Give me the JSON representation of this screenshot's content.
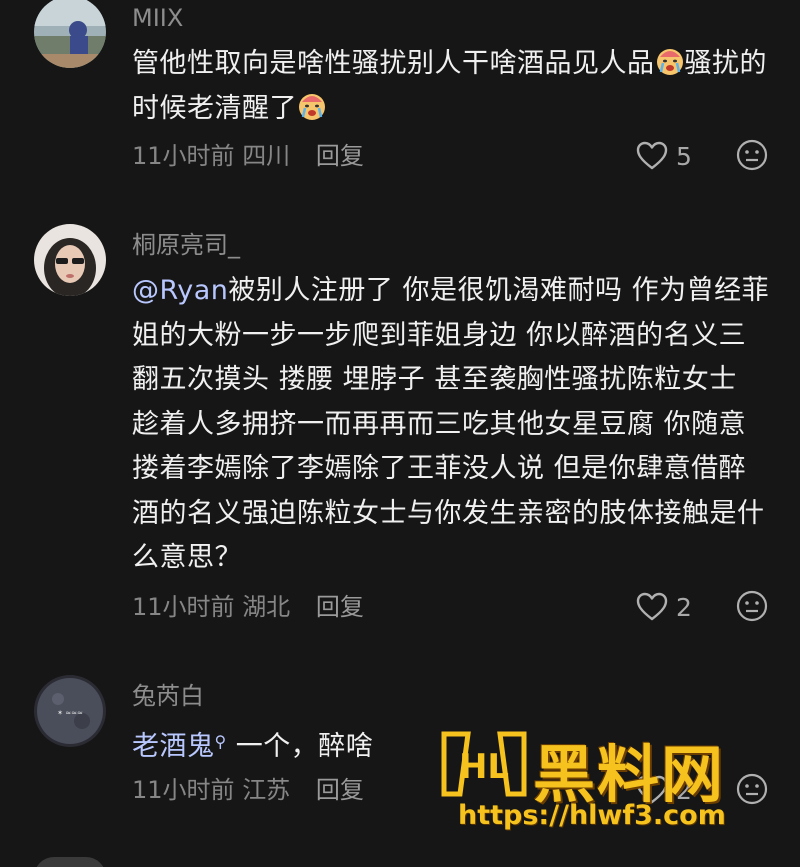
{
  "comments": [
    {
      "username": "MIIX",
      "text_before": "管他性取向是啥性骚扰别人干啥酒品见人品",
      "text_mid": "骚扰的时候老清醒了",
      "time": "11小时前",
      "location": "四川",
      "reply_label": "回复",
      "likes": "5"
    },
    {
      "username": "桐原亮司_",
      "mention": "@Ryan",
      "text": "被别人注册了 你是很饥渴难耐吗 作为曾经菲姐的大粉一步一步爬到菲姐身边 你以醉酒的名义三翻五次摸头 搂腰 埋脖子 甚至袭胸性骚扰陈粒女士 趁着人多拥挤一而再再而三吃其他女星豆腐 你随意搂着李嫣除了李嫣除了王菲没人说 但是你肆意借醉酒的名义强迫陈粒女士与你发生亲密的肢体接触是什么意思？",
      "time": "11小时前",
      "location": "湖北",
      "reply_label": "回复",
      "likes": "2"
    },
    {
      "username": "兔芮白",
      "link_text": "老酒鬼",
      "text": " 一个，醉啥",
      "time": "11小时前",
      "location": "江苏",
      "reply_label": "回复",
      "likes": "2"
    }
  ],
  "watermark": {
    "title": "黑料网",
    "url": "https://hlwf3.com"
  },
  "colors": {
    "background": "#161616",
    "watermark": "#f6c21e"
  }
}
